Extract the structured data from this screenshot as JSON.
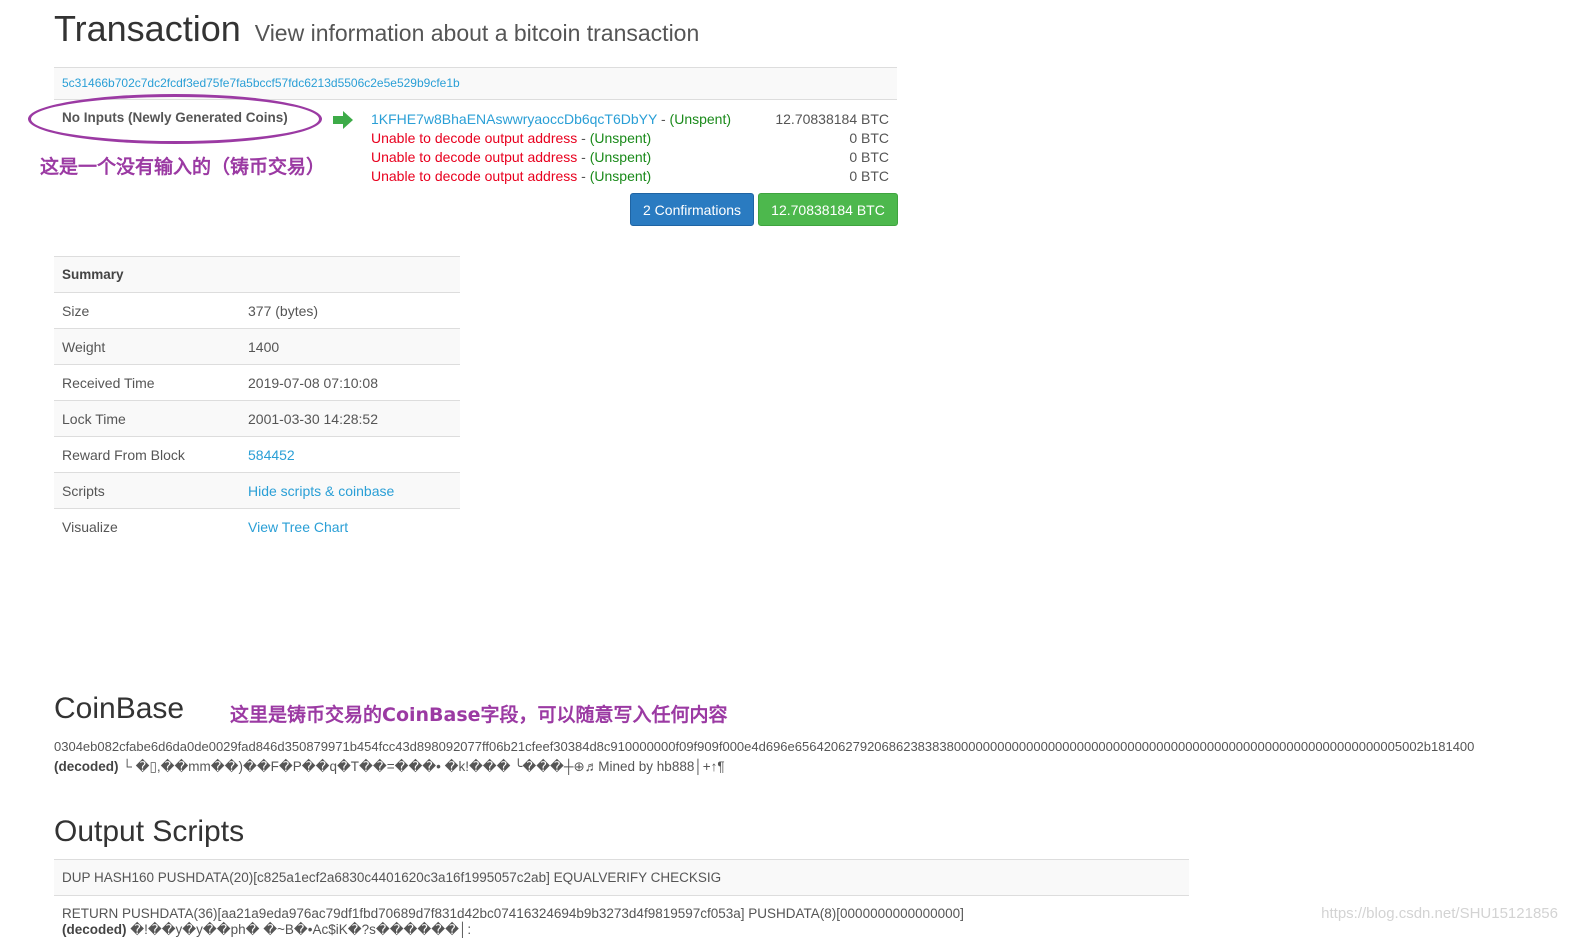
{
  "header": {
    "title": "Transaction",
    "subtitle": "View information about a bitcoin transaction"
  },
  "transaction": {
    "hash": "5c31466b702c7dc2fcdf3ed75fe7fa5bccf57fdc6213d5506c2e5e529b9cfe1b",
    "inputs_label": "No Inputs (Newly Generated Coins)",
    "arrow_icon": "right-arrow-icon",
    "outputs": [
      {
        "address": "1KFHE7w8BhaENAswwryaoccDb6qcT6DbYY",
        "error": false,
        "sep": " - ",
        "status": "(Unspent)",
        "amount": "12.70838184 BTC"
      },
      {
        "address": "Unable to decode output address",
        "error": true,
        "sep": " - ",
        "status": "(Unspent)",
        "amount": "0 BTC"
      },
      {
        "address": "Unable to decode output address",
        "error": true,
        "sep": " - ",
        "status": "(Unspent)",
        "amount": "0 BTC"
      },
      {
        "address": "Unable to decode output address",
        "error": true,
        "sep": " - ",
        "status": "(Unspent)",
        "amount": "0 BTC"
      }
    ],
    "confirmations_label": "2 Confirmations",
    "total_label": "12.70838184 BTC"
  },
  "annotations": {
    "inputs_note": "这是一个没有输入的（铸币交易）",
    "coinbase_note": "这里是铸币交易的CoinBase字段，可以随意写入任何内容",
    "color": "#9b3aa3"
  },
  "summary": {
    "title": "Summary",
    "rows": [
      {
        "key": "Size",
        "value": "377 (bytes)"
      },
      {
        "key": "Weight",
        "value": "1400"
      },
      {
        "key": "Received Time",
        "value": "2019-07-08 07:10:08"
      },
      {
        "key": "Lock Time",
        "value": "2001-03-30 14:28:52"
      },
      {
        "key": "Reward From Block",
        "value": "584452"
      },
      {
        "key": "Scripts",
        "value": "Hide scripts & coinbase"
      },
      {
        "key": "Visualize",
        "value": "View Tree Chart"
      }
    ]
  },
  "coinbase": {
    "title": "CoinBase",
    "hex": "0304eb082cfabe6d6da0de0029fad846d350879971b454fcc43d898092077ff06b21cfeef30384d8c910000000f09f909f000e4d696e656420627920686238383800000000000000000000000000000000000000000000000000000000000005002b181400",
    "decoded_label": "(decoded)",
    "decoded_text": "└ �▯,��mm��)��F�P��q�T��=���• �k!��� ╰���┼⊕♬Mined by hb888│+↑¶"
  },
  "output_scripts": {
    "title": "Output Scripts",
    "rows": [
      "DUP HASH160 PUSHDATA(20)[c825a1ecf2a6830c4401620c3a16f1995057c2ab] EQUALVERIFY CHECKSIG",
      "RETURN PUSHDATA(36)[aa21a9eda976ac79df1fbd70689d7f831d42bc07416324694b9b3273d4f9819597cf053a] PUSHDATA(8)[0000000000000000]"
    ],
    "decoded_label": "(decoded)",
    "decoded_text": "�!��y�y��ph� �~B�•Ac$iK�?s������│:"
  },
  "watermark": "https://blog.csdn.net/SHU15121856",
  "colors": {
    "link": "#2a9fd6",
    "error": "#e8001e",
    "unspent": "#1a8a1a",
    "confirm_button": "#2a7bc1",
    "amount_button": "#4db84d"
  }
}
